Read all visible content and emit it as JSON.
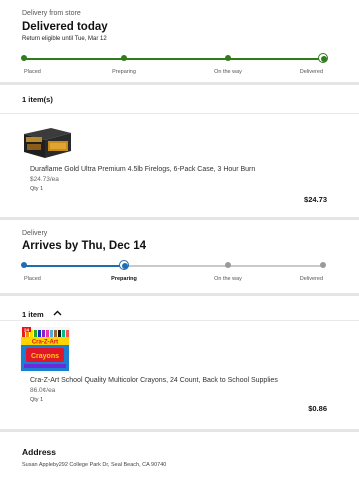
{
  "order1": {
    "overline": "Delivery from store",
    "title": "Delivered today",
    "return_note": "Return eligible until Tue, Mar 12",
    "steps": [
      "Placed",
      "Preparing",
      "On the way",
      "Delivered"
    ],
    "current_step": 4,
    "accent": "#2e7d1a",
    "items_count": "1 item(s)",
    "product": {
      "name": "Duraflame Gold Ultra Premium 4.5lb Firelogs, 6-Pack Case, 3 Hour Burn",
      "unit_price": "$24.73/ea",
      "qty": "Qty 1",
      "total": "$24.73",
      "image_icon": "firelog-box-icon",
      "image_text": "duraflame"
    }
  },
  "order2": {
    "overline": "Delivery",
    "title": "Arrives by Thu, Dec 14",
    "steps": [
      "Placed",
      "Preparing",
      "On the way",
      "Delivered"
    ],
    "current_step": 2,
    "accent": "#1f6fb0",
    "items_count": "1 item",
    "collapse_icon": "chevron-up-icon",
    "product": {
      "name": "Cra-Z-Art School Quality Multicolor Crayons, 24 Count, Back to School Supplies",
      "unit_price": "86.0¢/ea",
      "qty": "Qty 1",
      "total": "$0.86",
      "image_icon": "crayon-box-icon",
      "image_count": "24",
      "image_brand": "Cra-Z-Art",
      "image_word": "Crayons"
    }
  },
  "address": {
    "title": "Address",
    "text": "Susan Appleby292 College Park Dr, Seal Beach, CA 90740"
  }
}
